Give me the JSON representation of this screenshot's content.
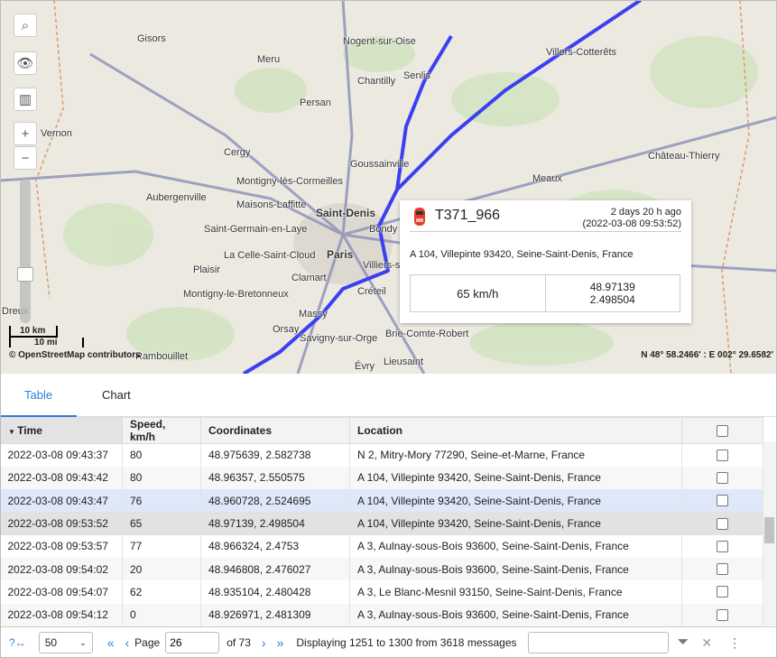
{
  "map": {
    "towns": [
      "Gisors",
      "Meru",
      "Nogent-sur-Oise",
      "Villers-Cotterêts",
      "Chantilly",
      "Senlis",
      "Persan",
      "Vernon",
      "Cergy",
      "Goussainville",
      "Château-Thierry",
      "Montigny-lès-Cormeilles",
      "Aubergenville",
      "Maisons-Laffitte",
      "Saint-Denis",
      "Saint-Germain-en-Laye",
      "Meaux",
      "Bondy",
      "Paris",
      "La Celle-Saint-Cloud",
      "Plaisir",
      "Villiers-s...",
      "Clamart",
      "Créteil",
      "Montigny-le-Bretonneux",
      "Massy",
      "Orsay",
      "Savigny-sur-Orge",
      "Brie-Comte-Robert",
      "Dreux",
      "Rambouillet",
      "Évry",
      "Lieusaint"
    ],
    "scale_km": "10 km",
    "scale_mi": "10 mi",
    "attribution": "© OpenStreetMap contributors",
    "coordinates": "N 48° 58.2466' : E 002° 29.6582'",
    "zoom_in": "+",
    "zoom_out": "−",
    "route_color": "#3b3ff0",
    "popup": {
      "unit": "T371_966",
      "ago": "2 days 20 h ago",
      "time": "(2022-03-08 09:53:52)",
      "address": "A 104, Villepinte 93420, Seine-Saint-Denis, France",
      "speed": "65 km/h",
      "lat": "48.97139",
      "lon": "2.498504"
    }
  },
  "tabs": [
    {
      "label": "Table"
    },
    {
      "label": "Chart"
    }
  ],
  "table": {
    "headers": [
      "Time",
      "Speed, km/h",
      "Coordinates",
      "Location"
    ],
    "rows": [
      [
        "2022-03-08 09:43:37",
        "80",
        "48.975639, 2.582738",
        "N 2, Mitry-Mory 77290, Seine-et-Marne, France"
      ],
      [
        "2022-03-08 09:43:42",
        "80",
        "48.96357, 2.550575",
        "A 104, Villepinte 93420, Seine-Saint-Denis, France"
      ],
      [
        "2022-03-08 09:43:47",
        "76",
        "48.960728, 2.524695",
        "A 104, Villepinte 93420, Seine-Saint-Denis, France"
      ],
      [
        "2022-03-08 09:53:52",
        "65",
        "48.97139, 2.498504",
        "A 104, Villepinte 93420, Seine-Saint-Denis, France"
      ],
      [
        "2022-03-08 09:53:57",
        "77",
        "48.966324, 2.4753",
        "A 3, Aulnay-sous-Bois 93600, Seine-Saint-Denis, France"
      ],
      [
        "2022-03-08 09:54:02",
        "20",
        "48.946808, 2.476027",
        "A 3, Aulnay-sous-Bois 93600, Seine-Saint-Denis, France"
      ],
      [
        "2022-03-08 09:54:07",
        "62",
        "48.935104, 2.480428",
        "A 3, Le Blanc-Mesnil 93150, Seine-Saint-Denis, France"
      ],
      [
        "2022-03-08 09:54:12",
        "0",
        "48.926971, 2.481309",
        "A 3, Aulnay-sous-Bois 93600, Seine-Saint-Denis, France"
      ]
    ]
  },
  "footer": {
    "page_size": "50",
    "page_label": "Page",
    "page": "26",
    "of": "of 73",
    "displaying": "Displaying 1251 to 1300 from 3618 messages",
    "filter_placeholder": ""
  }
}
